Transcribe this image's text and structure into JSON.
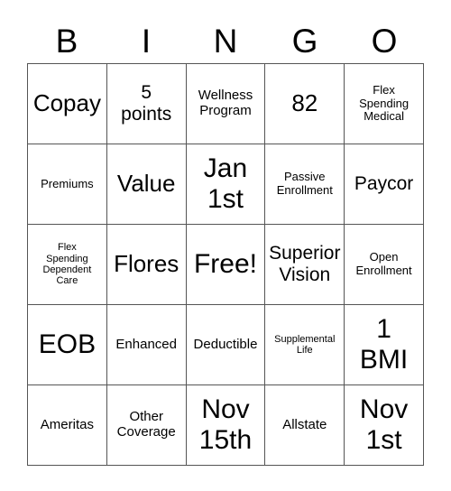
{
  "card": {
    "headers": [
      "B",
      "I",
      "N",
      "G",
      "O"
    ],
    "rows": [
      [
        {
          "text": "Copay",
          "size": "lg"
        },
        {
          "text": "5\npoints",
          "size": "md"
        },
        {
          "text": "Wellness\nProgram",
          "size": "sm"
        },
        {
          "text": "82",
          "size": "lg"
        },
        {
          "text": "Flex\nSpending\nMedical",
          "size": "xs"
        }
      ],
      [
        {
          "text": "Premiums",
          "size": "xs"
        },
        {
          "text": "Value",
          "size": "lg"
        },
        {
          "text": "Jan\n1st",
          "size": "xl"
        },
        {
          "text": "Passive\nEnrollment",
          "size": "xs"
        },
        {
          "text": "Paycor",
          "size": "md"
        }
      ],
      [
        {
          "text": "Flex\nSpending\nDependent\nCare",
          "size": "xxs"
        },
        {
          "text": "Flores",
          "size": "lg"
        },
        {
          "text": "Free!",
          "size": "xl"
        },
        {
          "text": "Superior\nVision",
          "size": "md"
        },
        {
          "text": "Open\nEnrollment",
          "size": "xs"
        }
      ],
      [
        {
          "text": "EOB",
          "size": "xl"
        },
        {
          "text": "Enhanced",
          "size": "sm"
        },
        {
          "text": "Deductible",
          "size": "sm"
        },
        {
          "text": "Supplemental\nLife",
          "size": "xxs"
        },
        {
          "text": "1\nBMI",
          "size": "xl"
        }
      ],
      [
        {
          "text": "Ameritas",
          "size": "sm"
        },
        {
          "text": "Other\nCoverage",
          "size": "sm"
        },
        {
          "text": "Nov\n15th",
          "size": "xl"
        },
        {
          "text": "Allstate",
          "size": "sm"
        },
        {
          "text": "Nov\n1st",
          "size": "xl"
        }
      ]
    ]
  }
}
